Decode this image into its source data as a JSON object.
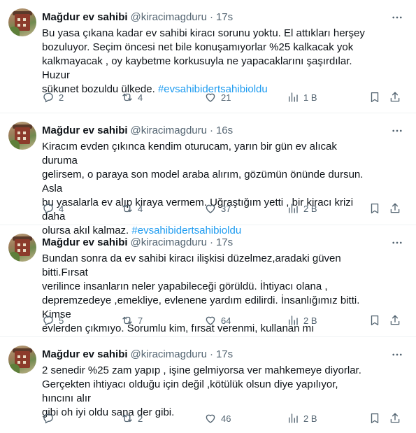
{
  "colors": {
    "accent": "#1d9bf0",
    "secondary_text": "#536471",
    "divider": "#eff3f4"
  },
  "tweets": [
    {
      "name": "Mağdur ev sahibi",
      "handle": "@kiracimagduru",
      "dot": "·",
      "time": "17s",
      "lines": [
        "Bu yasa çıkana kadar ev sahibi kiracı sorunu yoktu. El attıkları herşey",
        "bozuluyor. Seçim öncesi net bile konuşamıyorlar %25 kalkacak yok",
        "kalkmayacak , oy kaybetme korkusuyla ne yapacaklarını şaşırdılar. Huzur",
        "sükunet bozuldu ülkede. "
      ],
      "hashtag": "#evsahibidertsahibioldu",
      "replies": "2",
      "retweets": "4",
      "likes": "21",
      "views": "1 B"
    },
    {
      "name": "Mağdur ev sahibi",
      "handle": "@kiracimagduru",
      "dot": "·",
      "time": "16s",
      "lines": [
        "Kiracım evden çıkınca kendim oturucam, yarın bir gün ev alıcak duruma",
        "gelirsem, o paraya son model araba alırım, gözümün önünde dursun. Asla",
        "bu yasalarla ev alıp kiraya vermem. Uğraştığım yetti , bir kiracı krizi daha",
        "olursa akıl kalmaz. "
      ],
      "hashtag": "#evsahibidertsahibioldu",
      "replies": "4",
      "retweets": "4",
      "likes": "37",
      "views": "2 B"
    },
    {
      "name": "Mağdur ev sahibi",
      "handle": "@kiracimagduru",
      "dot": "·",
      "time": "17s",
      "lines": [
        "Bundan sonra da ev sahibi kiracı ilişkisi düzelmez,aradaki güven bitti.Fırsat",
        "verilince insanların neler yapabileceği görüldü. İhtiyacı olana ,",
        "depremzedeye ,emekliye, evlenene yardım edilirdi. İnsanlığımız bitti. Kimse",
        "evlerden çıkmıyo. Sorumlu kim, fırsat verenmi, kullanan mı"
      ],
      "hashtag": "",
      "replies": "5",
      "retweets": "7",
      "likes": "64",
      "views": "2 B"
    },
    {
      "name": "Mağdur ev sahibi",
      "handle": "@kiracimagduru",
      "dot": "·",
      "time": "17s",
      "lines": [
        "2 senedir %25 zam yapıp , işine gelmiyorsa ver mahkemeye diyorlar.",
        "Gerçekten ihtiyacı olduğu için değil ,kötülük olsun diye yapılıyor, hıncını alır",
        "gibi oh iyi oldu sana der gibi."
      ],
      "hashtag": "",
      "replies": "",
      "retweets": "2",
      "likes": "46",
      "views": "2 B"
    }
  ]
}
